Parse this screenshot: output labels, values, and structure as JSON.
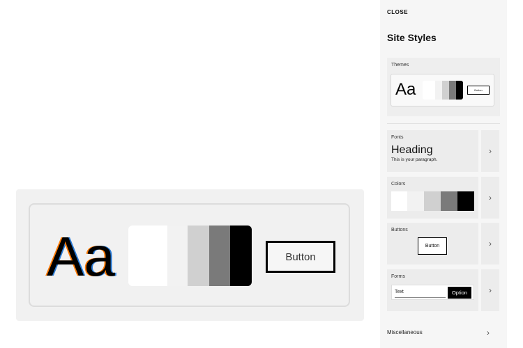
{
  "preview": {
    "aa_text": "Aa",
    "button_label": "Button",
    "swatches": [
      "#ffffff",
      "#f2f2f2",
      "#d0d0d0",
      "#7a7a7a",
      "#000000"
    ]
  },
  "panel": {
    "close_label": "CLOSE",
    "title": "Site Styles",
    "themes": {
      "label": "Themes",
      "aa_text": "Aa",
      "button_label": "Button"
    },
    "fonts": {
      "label": "Fonts",
      "heading": "Heading",
      "paragraph": "This is your paragraph."
    },
    "colors": {
      "label": "Colors",
      "swatches": [
        "#ffffff",
        "#f2f2f2",
        "#d0d0d0",
        "#7a7a7a",
        "#000000"
      ]
    },
    "buttons": {
      "label": "Buttons",
      "sample_label": "Button"
    },
    "forms": {
      "label": "Forms",
      "text_field": "Text",
      "option_label": "Option"
    },
    "misc": {
      "label": "Miscellaneous"
    },
    "chevron": "›"
  }
}
